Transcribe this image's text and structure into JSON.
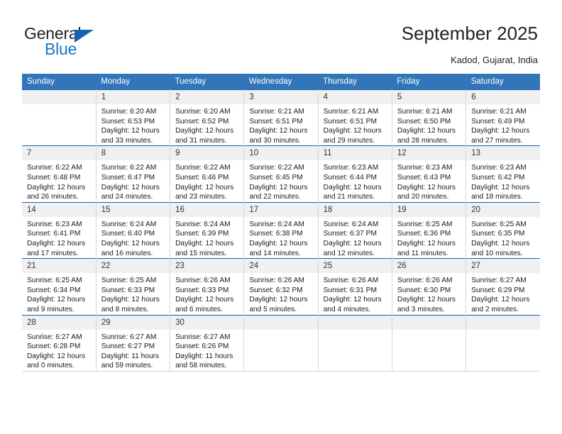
{
  "brand": {
    "name_dark": "General",
    "name_blue": "Blue",
    "triangle_color": "#1463ad",
    "blue_color": "#1b76c9"
  },
  "header": {
    "title": "September 2025",
    "location": "Kadod, Gujarat, India"
  },
  "calendar": {
    "header_bg": "#3275b9",
    "header_text_color": "#ffffff",
    "daynum_bg": "#f0f0f0",
    "week_separator_color": "#1463ad",
    "weekdays": [
      "Sunday",
      "Monday",
      "Tuesday",
      "Wednesday",
      "Thursday",
      "Friday",
      "Saturday"
    ],
    "weeks": [
      [
        {
          "day": "",
          "sunrise": "",
          "sunset": "",
          "daylight_line1": "",
          "daylight_line2": ""
        },
        {
          "day": "1",
          "sunrise": "Sunrise: 6:20 AM",
          "sunset": "Sunset: 6:53 PM",
          "daylight_line1": "Daylight: 12 hours",
          "daylight_line2": "and 33 minutes."
        },
        {
          "day": "2",
          "sunrise": "Sunrise: 6:20 AM",
          "sunset": "Sunset: 6:52 PM",
          "daylight_line1": "Daylight: 12 hours",
          "daylight_line2": "and 31 minutes."
        },
        {
          "day": "3",
          "sunrise": "Sunrise: 6:21 AM",
          "sunset": "Sunset: 6:51 PM",
          "daylight_line1": "Daylight: 12 hours",
          "daylight_line2": "and 30 minutes."
        },
        {
          "day": "4",
          "sunrise": "Sunrise: 6:21 AM",
          "sunset": "Sunset: 6:51 PM",
          "daylight_line1": "Daylight: 12 hours",
          "daylight_line2": "and 29 minutes."
        },
        {
          "day": "5",
          "sunrise": "Sunrise: 6:21 AM",
          "sunset": "Sunset: 6:50 PM",
          "daylight_line1": "Daylight: 12 hours",
          "daylight_line2": "and 28 minutes."
        },
        {
          "day": "6",
          "sunrise": "Sunrise: 6:21 AM",
          "sunset": "Sunset: 6:49 PM",
          "daylight_line1": "Daylight: 12 hours",
          "daylight_line2": "and 27 minutes."
        }
      ],
      [
        {
          "day": "7",
          "sunrise": "Sunrise: 6:22 AM",
          "sunset": "Sunset: 6:48 PM",
          "daylight_line1": "Daylight: 12 hours",
          "daylight_line2": "and 26 minutes."
        },
        {
          "day": "8",
          "sunrise": "Sunrise: 6:22 AM",
          "sunset": "Sunset: 6:47 PM",
          "daylight_line1": "Daylight: 12 hours",
          "daylight_line2": "and 24 minutes."
        },
        {
          "day": "9",
          "sunrise": "Sunrise: 6:22 AM",
          "sunset": "Sunset: 6:46 PM",
          "daylight_line1": "Daylight: 12 hours",
          "daylight_line2": "and 23 minutes."
        },
        {
          "day": "10",
          "sunrise": "Sunrise: 6:22 AM",
          "sunset": "Sunset: 6:45 PM",
          "daylight_line1": "Daylight: 12 hours",
          "daylight_line2": "and 22 minutes."
        },
        {
          "day": "11",
          "sunrise": "Sunrise: 6:23 AM",
          "sunset": "Sunset: 6:44 PM",
          "daylight_line1": "Daylight: 12 hours",
          "daylight_line2": "and 21 minutes."
        },
        {
          "day": "12",
          "sunrise": "Sunrise: 6:23 AM",
          "sunset": "Sunset: 6:43 PM",
          "daylight_line1": "Daylight: 12 hours",
          "daylight_line2": "and 20 minutes."
        },
        {
          "day": "13",
          "sunrise": "Sunrise: 6:23 AM",
          "sunset": "Sunset: 6:42 PM",
          "daylight_line1": "Daylight: 12 hours",
          "daylight_line2": "and 18 minutes."
        }
      ],
      [
        {
          "day": "14",
          "sunrise": "Sunrise: 6:23 AM",
          "sunset": "Sunset: 6:41 PM",
          "daylight_line1": "Daylight: 12 hours",
          "daylight_line2": "and 17 minutes."
        },
        {
          "day": "15",
          "sunrise": "Sunrise: 6:24 AM",
          "sunset": "Sunset: 6:40 PM",
          "daylight_line1": "Daylight: 12 hours",
          "daylight_line2": "and 16 minutes."
        },
        {
          "day": "16",
          "sunrise": "Sunrise: 6:24 AM",
          "sunset": "Sunset: 6:39 PM",
          "daylight_line1": "Daylight: 12 hours",
          "daylight_line2": "and 15 minutes."
        },
        {
          "day": "17",
          "sunrise": "Sunrise: 6:24 AM",
          "sunset": "Sunset: 6:38 PM",
          "daylight_line1": "Daylight: 12 hours",
          "daylight_line2": "and 14 minutes."
        },
        {
          "day": "18",
          "sunrise": "Sunrise: 6:24 AM",
          "sunset": "Sunset: 6:37 PM",
          "daylight_line1": "Daylight: 12 hours",
          "daylight_line2": "and 12 minutes."
        },
        {
          "day": "19",
          "sunrise": "Sunrise: 6:25 AM",
          "sunset": "Sunset: 6:36 PM",
          "daylight_line1": "Daylight: 12 hours",
          "daylight_line2": "and 11 minutes."
        },
        {
          "day": "20",
          "sunrise": "Sunrise: 6:25 AM",
          "sunset": "Sunset: 6:35 PM",
          "daylight_line1": "Daylight: 12 hours",
          "daylight_line2": "and 10 minutes."
        }
      ],
      [
        {
          "day": "21",
          "sunrise": "Sunrise: 6:25 AM",
          "sunset": "Sunset: 6:34 PM",
          "daylight_line1": "Daylight: 12 hours",
          "daylight_line2": "and 9 minutes."
        },
        {
          "day": "22",
          "sunrise": "Sunrise: 6:25 AM",
          "sunset": "Sunset: 6:33 PM",
          "daylight_line1": "Daylight: 12 hours",
          "daylight_line2": "and 8 minutes."
        },
        {
          "day": "23",
          "sunrise": "Sunrise: 6:26 AM",
          "sunset": "Sunset: 6:33 PM",
          "daylight_line1": "Daylight: 12 hours",
          "daylight_line2": "and 6 minutes."
        },
        {
          "day": "24",
          "sunrise": "Sunrise: 6:26 AM",
          "sunset": "Sunset: 6:32 PM",
          "daylight_line1": "Daylight: 12 hours",
          "daylight_line2": "and 5 minutes."
        },
        {
          "day": "25",
          "sunrise": "Sunrise: 6:26 AM",
          "sunset": "Sunset: 6:31 PM",
          "daylight_line1": "Daylight: 12 hours",
          "daylight_line2": "and 4 minutes."
        },
        {
          "day": "26",
          "sunrise": "Sunrise: 6:26 AM",
          "sunset": "Sunset: 6:30 PM",
          "daylight_line1": "Daylight: 12 hours",
          "daylight_line2": "and 3 minutes."
        },
        {
          "day": "27",
          "sunrise": "Sunrise: 6:27 AM",
          "sunset": "Sunset: 6:29 PM",
          "daylight_line1": "Daylight: 12 hours",
          "daylight_line2": "and 2 minutes."
        }
      ],
      [
        {
          "day": "28",
          "sunrise": "Sunrise: 6:27 AM",
          "sunset": "Sunset: 6:28 PM",
          "daylight_line1": "Daylight: 12 hours",
          "daylight_line2": "and 0 minutes."
        },
        {
          "day": "29",
          "sunrise": "Sunrise: 6:27 AM",
          "sunset": "Sunset: 6:27 PM",
          "daylight_line1": "Daylight: 11 hours",
          "daylight_line2": "and 59 minutes."
        },
        {
          "day": "30",
          "sunrise": "Sunrise: 6:27 AM",
          "sunset": "Sunset: 6:26 PM",
          "daylight_line1": "Daylight: 11 hours",
          "daylight_line2": "and 58 minutes."
        },
        {
          "day": "",
          "sunrise": "",
          "sunset": "",
          "daylight_line1": "",
          "daylight_line2": ""
        },
        {
          "day": "",
          "sunrise": "",
          "sunset": "",
          "daylight_line1": "",
          "daylight_line2": ""
        },
        {
          "day": "",
          "sunrise": "",
          "sunset": "",
          "daylight_line1": "",
          "daylight_line2": ""
        },
        {
          "day": "",
          "sunrise": "",
          "sunset": "",
          "daylight_line1": "",
          "daylight_line2": ""
        }
      ]
    ]
  }
}
